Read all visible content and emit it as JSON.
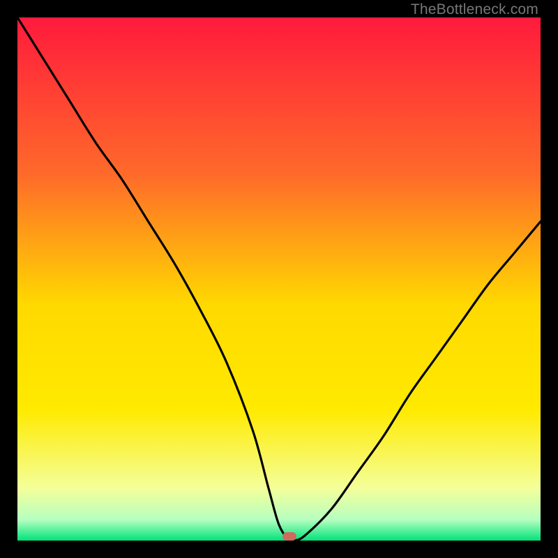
{
  "watermark": "TheBottleneck.com",
  "marker_color": "#cf6a60",
  "chart_data": {
    "type": "line",
    "title": "",
    "xlabel": "",
    "ylabel": "",
    "xlim": [
      0,
      100
    ],
    "ylim": [
      0,
      100
    ],
    "grid": false,
    "x": [
      0,
      5,
      10,
      15,
      20,
      25,
      30,
      35,
      40,
      45,
      48,
      50,
      52,
      53,
      55,
      60,
      65,
      70,
      75,
      80,
      85,
      90,
      95,
      100
    ],
    "values": [
      100,
      92,
      84,
      76,
      69,
      61,
      53,
      44,
      34,
      21,
      10,
      3,
      0,
      0,
      1,
      6,
      13,
      20,
      28,
      35,
      42,
      49,
      55,
      61
    ],
    "minimum_x": 52,
    "background_gradient": {
      "top": "#ff1a3c",
      "mid_upper": "#ff8a2a",
      "mid": "#ffd900",
      "mid_lower": "#f7ff66",
      "near_bottom": "#cfffb0",
      "bottom": "#00e37a"
    }
  }
}
